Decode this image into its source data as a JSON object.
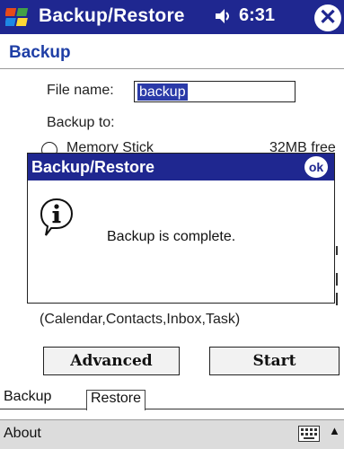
{
  "titlebar": {
    "title": "Backup/Restore",
    "time": "6:31",
    "close_glyph": "✕",
    "colors": {
      "titlebar_bg": "#1f2790",
      "accent_text": "#1f3fa6"
    }
  },
  "page": {
    "section_title": "Backup"
  },
  "form": {
    "file_name_label": "File name:",
    "file_name_value": "backup",
    "backup_to_label": "Backup to:",
    "memory_option_label": "Memory Stick",
    "free_text": "32MB free",
    "apps_text": "(Calendar,Contacts,Inbox,Task)"
  },
  "dialog": {
    "title": "Backup/Restore",
    "ok_label": "ok",
    "message": "Backup is complete.",
    "icon": "info-icon"
  },
  "buttons": {
    "advanced": "Advanced",
    "start": "Start"
  },
  "tabs": [
    {
      "label": "Backup",
      "selected": true
    },
    {
      "label": "Restore",
      "selected": false
    }
  ],
  "menubar": {
    "about": "About",
    "keyboard_icon": "keyboard-icon",
    "arrow_glyph": "▲"
  }
}
